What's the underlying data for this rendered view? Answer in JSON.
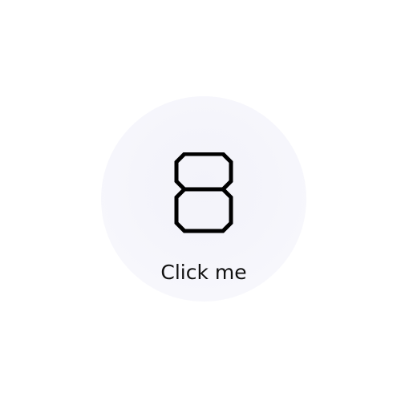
{
  "button": {
    "digit": "8",
    "digit_icon": "seven-segment-digit-8",
    "label": "Click me",
    "background_color": "#f5f5fb",
    "text_color": "#111111",
    "digit_color": "#000000"
  }
}
